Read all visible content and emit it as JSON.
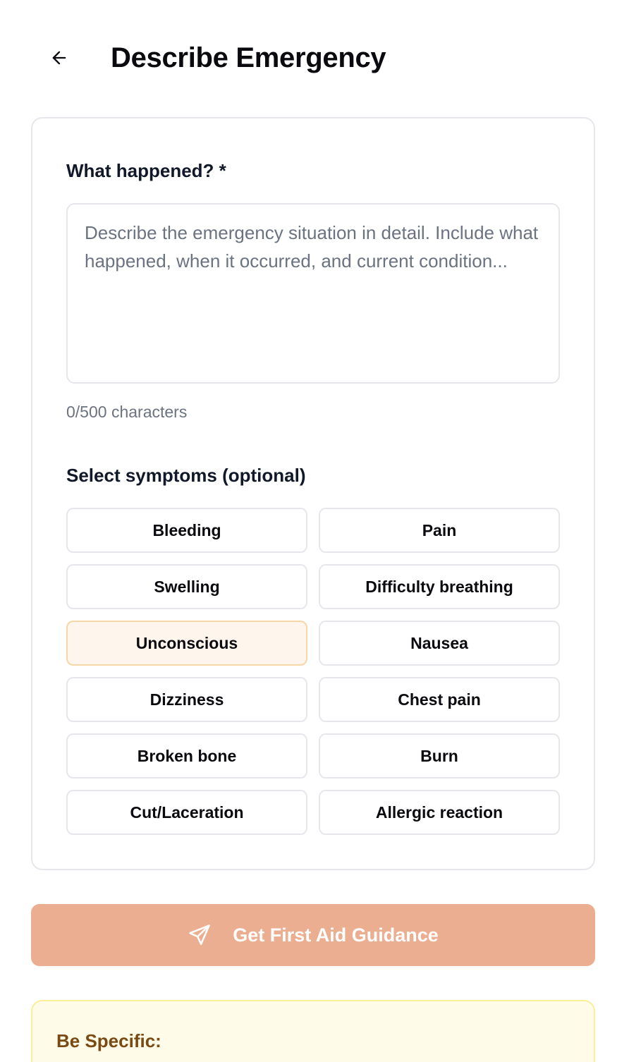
{
  "header": {
    "title": "Describe Emergency"
  },
  "form": {
    "description_label": "What happened? *",
    "description_value": "",
    "description_placeholder": "Describe the emergency situation in detail. Include what happened, when it occurred, and current condition...",
    "char_count": "0/500 characters",
    "symptoms_label": "Select symptoms (optional)",
    "symptoms": [
      {
        "label": "Bleeding",
        "selected": false
      },
      {
        "label": "Pain",
        "selected": false
      },
      {
        "label": "Swelling",
        "selected": false
      },
      {
        "label": "Difficulty breathing",
        "selected": false
      },
      {
        "label": "Unconscious",
        "selected": true
      },
      {
        "label": "Nausea",
        "selected": false
      },
      {
        "label": "Dizziness",
        "selected": false
      },
      {
        "label": "Chest pain",
        "selected": false
      },
      {
        "label": "Broken bone",
        "selected": false
      },
      {
        "label": "Burn",
        "selected": false
      },
      {
        "label": "Cut/Laceration",
        "selected": false
      },
      {
        "label": "Allergic reaction",
        "selected": false
      }
    ]
  },
  "submit": {
    "label": "Get First Aid Guidance",
    "icon": "send-icon"
  },
  "tips": {
    "title": "Be Specific:"
  },
  "colors": {
    "submit_bg": "#ebae91",
    "selected_chip_bg": "#fef6ec",
    "selected_chip_border": "#f7d6a8",
    "tips_bg": "#fefce8",
    "tips_title": "#7a4a14"
  }
}
